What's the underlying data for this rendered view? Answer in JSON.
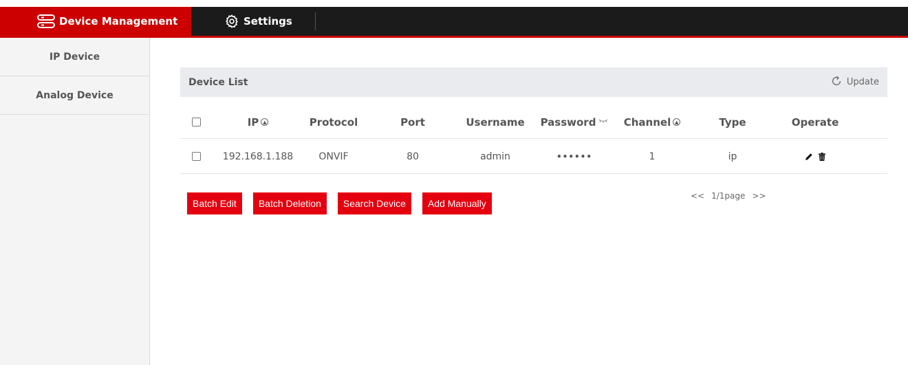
{
  "nav": {
    "device_management": "Device Management",
    "settings": "Settings"
  },
  "sidebar": {
    "items": [
      {
        "label": "IP Device"
      },
      {
        "label": "Analog Device"
      }
    ]
  },
  "device_list": {
    "title": "Device List",
    "update_label": "Update",
    "columns": {
      "ip": "IP",
      "protocol": "Protocol",
      "port": "Port",
      "username": "Username",
      "password": "Password",
      "channel": "Channel",
      "type": "Type",
      "operate": "Operate"
    },
    "rows": [
      {
        "ip": "192.168.1.188",
        "protocol": "ONVIF",
        "port": "80",
        "username": "admin",
        "password": "••••••",
        "channel": "1",
        "type": "ip"
      }
    ]
  },
  "actions": {
    "batch_edit": "Batch Edit",
    "batch_deletion": "Batch Deletion",
    "search_device": "Search Device",
    "add_manually": "Add Manually"
  },
  "pager": {
    "prev": "<<",
    "page": "1/1page",
    "next": ">>"
  },
  "colors": {
    "brand_red": "#cc0000",
    "button_red": "#e5000f",
    "topbar": "#1b1b1b"
  }
}
